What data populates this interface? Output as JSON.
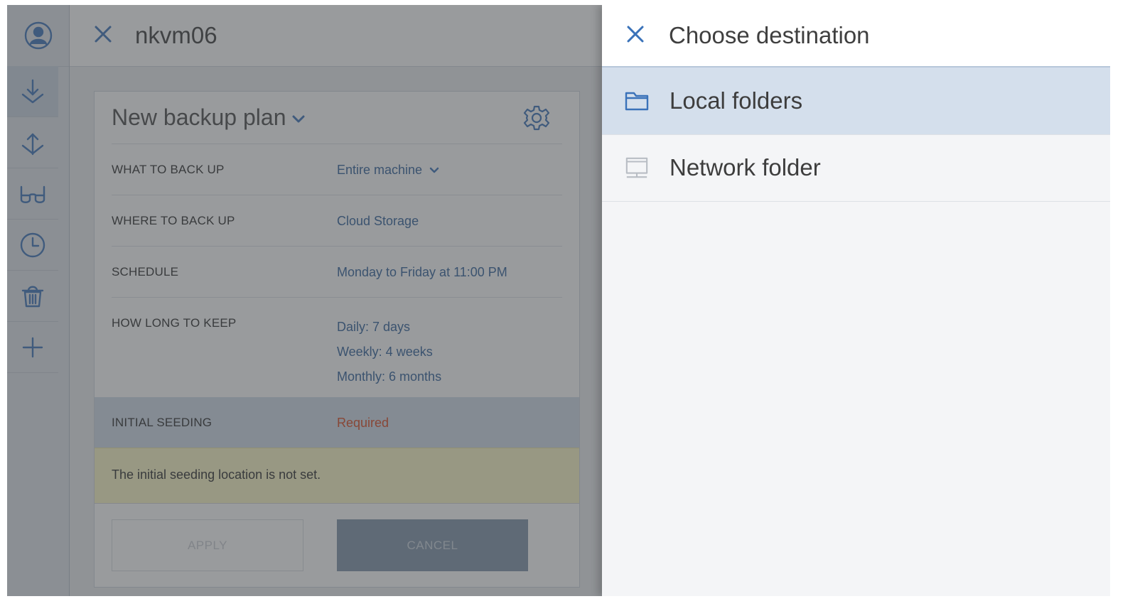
{
  "rail": {
    "items": [
      {
        "icon": "user-circle-icon"
      },
      {
        "icon": "backup-download-icon",
        "active": true
      },
      {
        "icon": "recovery-icon"
      },
      {
        "icon": "glasses-icon"
      },
      {
        "icon": "clock-icon"
      },
      {
        "icon": "trash-icon"
      },
      {
        "icon": "plus-icon"
      }
    ]
  },
  "machine_panel": {
    "title": "nkvm06",
    "plan": {
      "title": "New backup plan",
      "rows": {
        "what": {
          "label": "WHAT TO BACK UP",
          "value": "Entire machine"
        },
        "where": {
          "label": "WHERE TO BACK UP",
          "value": "Cloud Storage"
        },
        "schedule": {
          "label": "SCHEDULE",
          "value": "Monday to Friday at 11:00 PM"
        },
        "keep": {
          "label": "HOW LONG TO KEEP",
          "values": [
            "Daily: 7 days",
            "Weekly: 4 weeks",
            "Monthly: 6 months"
          ]
        },
        "seeding": {
          "label": "INITIAL SEEDING",
          "value": "Required"
        }
      },
      "warning": "The initial seeding location is not set.",
      "buttons": {
        "apply": "APPLY",
        "cancel": "CANCEL"
      }
    }
  },
  "destination_panel": {
    "title": "Choose destination",
    "items": [
      {
        "label": "Local folders",
        "icon": "folder-icon",
        "selected": true
      },
      {
        "label": "Network folder",
        "icon": "network-folder-icon",
        "selected": false
      }
    ]
  },
  "colors": {
    "accent": "#3a72b9",
    "required": "#d9461d",
    "warning_bg": "#fdf8c6",
    "selected_bg": "#d4dfec"
  }
}
